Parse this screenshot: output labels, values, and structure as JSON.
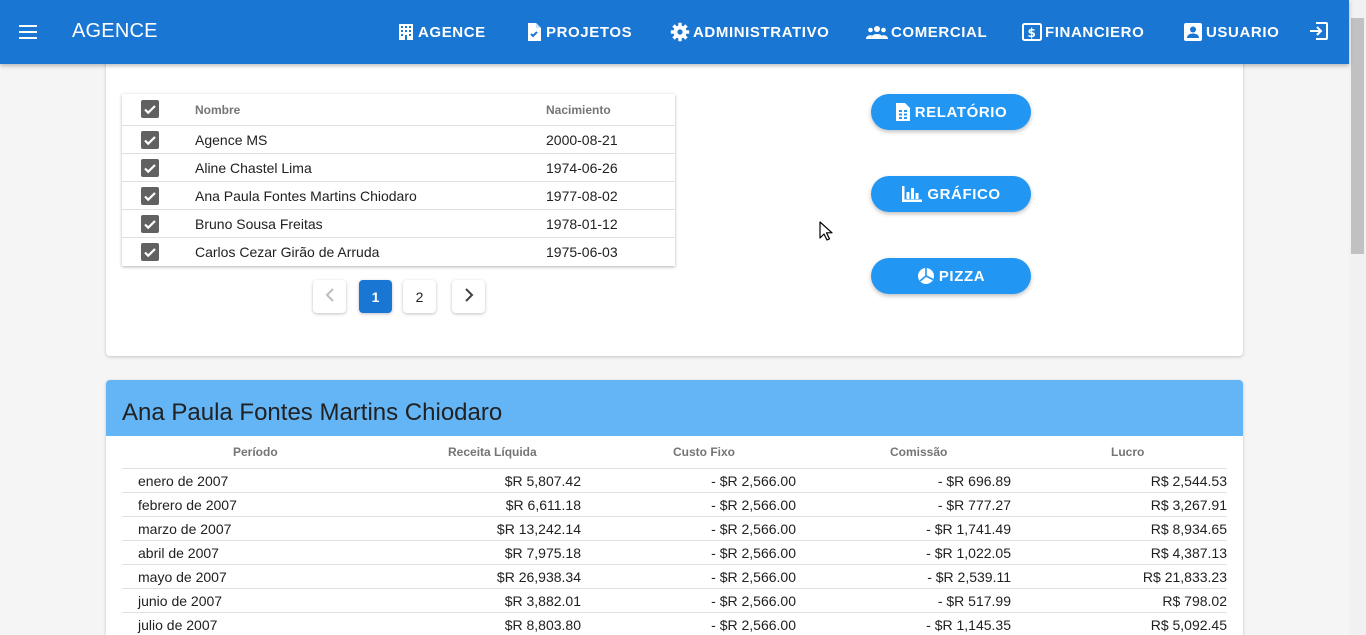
{
  "app": {
    "brand": "AGENCE"
  },
  "nav": [
    {
      "label": "AGENCE",
      "icon": "building-icon"
    },
    {
      "label": "PROJETOS",
      "icon": "document-check-icon"
    },
    {
      "label": "ADMINISTRATIVO",
      "icon": "gear-icon"
    },
    {
      "label": "COMERCIAL",
      "icon": "people-icon"
    },
    {
      "label": "FINANCIERO",
      "icon": "money-icon"
    },
    {
      "label": "USUARIO",
      "icon": "account-box-icon"
    }
  ],
  "consultants": {
    "headers": {
      "name": "Nombre",
      "birth": "Nacimiento"
    },
    "rows": [
      {
        "name": "Agence MS",
        "birth": "2000-08-21",
        "checked": true
      },
      {
        "name": "Aline Chastel Lima",
        "birth": "1974-06-26",
        "checked": true
      },
      {
        "name": "Ana Paula Fontes Martins Chiodaro",
        "birth": "1977-08-02",
        "checked": true
      },
      {
        "name": "Bruno Sousa Freitas",
        "birth": "1978-01-12",
        "checked": true
      },
      {
        "name": "Carlos Cezar Girão de Arruda",
        "birth": "1975-06-03",
        "checked": true
      }
    ]
  },
  "pagination": {
    "pages": [
      "1",
      "2"
    ],
    "current": "1"
  },
  "actions": {
    "report": "RELATÓRIO",
    "chart": "GRÁFICO",
    "pie": "PIZZA"
  },
  "report": {
    "title": "Ana Paula Fontes Martins Chiodaro",
    "headers": [
      "Período",
      "Receita Líquida",
      "Custo Fixo",
      "Comissão",
      "Lucro"
    ],
    "rows": [
      [
        "enero de 2007",
        "$R 5,807.42",
        "- $R 2,566.00",
        "- $R 696.89",
        "R$ 2,544.53"
      ],
      [
        "febrero de 2007",
        "$R 6,611.18",
        "- $R 2,566.00",
        "- $R 777.27",
        "R$ 3,267.91"
      ],
      [
        "marzo de 2007",
        "$R 13,242.14",
        "- $R 2,566.00",
        "- $R 1,741.49",
        "R$ 8,934.65"
      ],
      [
        "abril de 2007",
        "$R 7,975.18",
        "- $R 2,566.00",
        "- $R 1,022.05",
        "R$ 4,387.13"
      ],
      [
        "mayo de 2007",
        "$R 26,938.34",
        "- $R 2,566.00",
        "- $R 2,539.11",
        "R$ 21,833.23"
      ],
      [
        "junio de 2007",
        "$R 3,882.01",
        "- $R 2,566.00",
        "- $R 517.99",
        "R$ 798.02"
      ],
      [
        "julio de 2007",
        "$R 8,803.80",
        "- $R 2,566.00",
        "- $R 1,145.35",
        "R$ 5,092.45"
      ]
    ]
  },
  "colors": {
    "primary": "#1976d2",
    "accent": "#2196f3",
    "report_header": "#64b5f6",
    "checkbox": "#616161"
  }
}
